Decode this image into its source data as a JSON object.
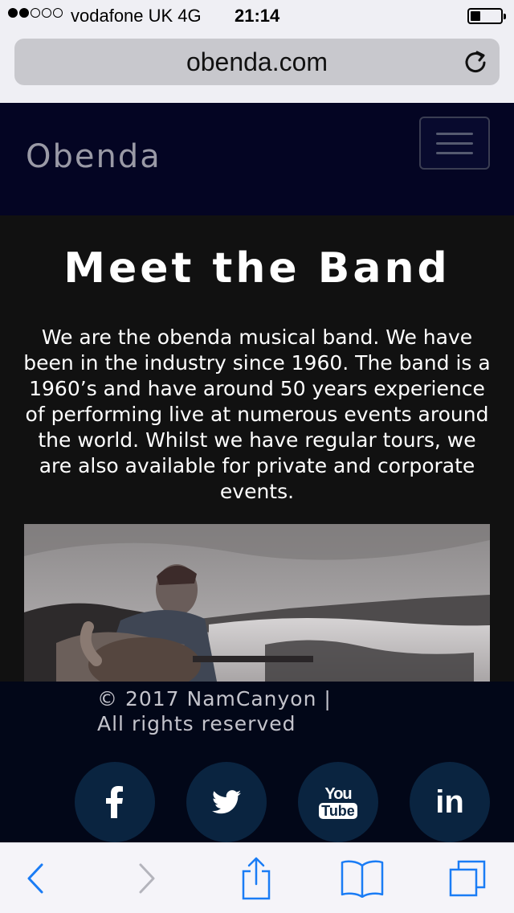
{
  "status_bar": {
    "signal_filled": 2,
    "signal_total": 5,
    "carrier": "vodafone UK  4G",
    "time": "21:14"
  },
  "browser": {
    "url": "obenda.com"
  },
  "site_nav": {
    "brand": "Obenda"
  },
  "main": {
    "title": "Meet the Band",
    "intro": "We are the obenda musical band. We have been in the industry since 1960. The band is a 1960’s and have around 50 years experience of performing live at numerous events around the world. Whilst we have regular tours, we are also available for private and corporate events."
  },
  "footer": {
    "copyright_line1": "© 2017 NamCanyon |",
    "copyright_line2": "All rights reserved",
    "social": [
      {
        "icon": "facebook-icon"
      },
      {
        "icon": "twitter-icon"
      },
      {
        "icon": "youtube-icon",
        "text_top": "You",
        "text_bottom": "Tube"
      },
      {
        "icon": "linkedin-icon",
        "text": "in"
      }
    ]
  },
  "toolbar": {
    "accent_color": "#1a7cf5",
    "disabled_color": "#b4b4bc"
  }
}
